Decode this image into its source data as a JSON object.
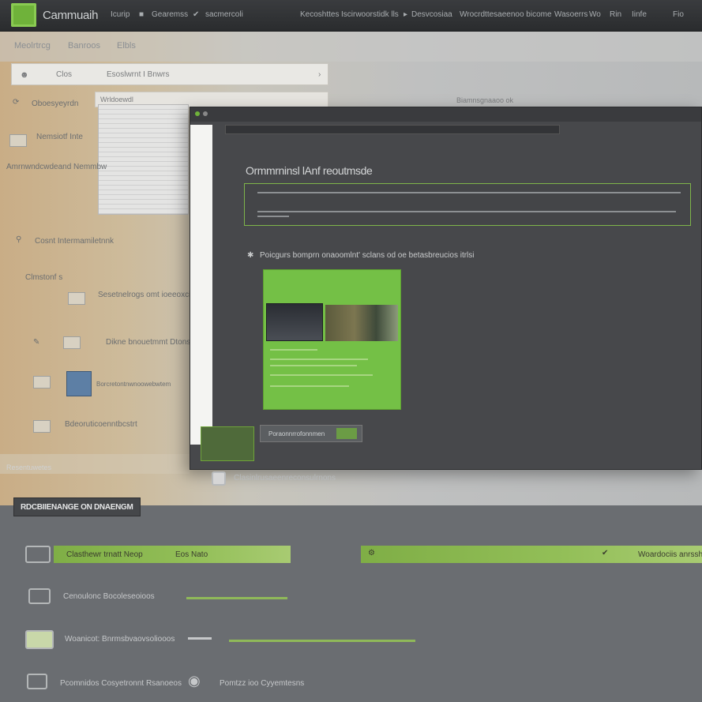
{
  "header": {
    "brand": "Cammuaih",
    "nav": [
      "Icurip",
      "Gearemss",
      "sacmercoli"
    ],
    "nav_right": [
      "Kecoshttes",
      "Iscirwoorstidk lls",
      "Desvcosiaa",
      "Wrocrdttesaeenoo bicome",
      "Wasoerrs",
      "Wo",
      "Rin",
      "Iinfe",
      "Fio"
    ]
  },
  "bg_window": {
    "tabs": [
      "Meolrtrcg",
      "Banroos",
      "Elbls"
    ],
    "address": [
      "Clos",
      "Esoslwrnt I Bnwrs"
    ],
    "address2": "Wrldoewdl",
    "sidebar": [
      "Oboesyeyrdn",
      "Nemsiotf Inte",
      "Amrnwndcwdeand Nemmbw",
      "Cosnt Intermamiletnnk",
      "Clmstonf s",
      "Sesetnelrogs omt ioeeoxcimmt",
      "Dikne bnouetmmt Dtonss",
      "Borcretontnwnoowebwtem",
      "Bdeoruticoenntbcstrt"
    ],
    "bottom_label": "Resentuwetes",
    "right_note": "Biamnsgnaaoo ok"
  },
  "fg_window": {
    "heading": "Ormmrninsl lAnf reoutmsde",
    "note": "Poicgurs bomprn onaoomlnt' sclans od oe betasbreucios itrlsi",
    "button_label": "Poraonnrrofonnmen"
  },
  "status_text": "Clasinlrusaeenreconsulrnons",
  "section": {
    "title": "RDCBIIENANGE ON DNAENGM",
    "rows": [
      {
        "label": "Clasthewr trnatt Neop",
        "sub": "Eos Nato",
        "right": "Woardociis anrsshcr"
      },
      {
        "label": "Cenoulonc Bocoleseoioos"
      },
      {
        "label": "Woanicot: Bnrmsbvaovsoliooos"
      },
      {
        "label": "Pcomnidos Cosyetronnt Rsanoeos",
        "sub": "Pomtzz ioo Cyyemtesns"
      }
    ]
  },
  "colors": {
    "accent": "#74c046",
    "topbar": "#2f3133",
    "window_dark": "#47484b",
    "background": "#6a6d71"
  },
  "icons": [
    "logo",
    "edit-icon",
    "check-icon",
    "star-icon",
    "folder-icon",
    "file-icon",
    "image-icon",
    "person-icon",
    "refresh-icon",
    "wifi-icon",
    "chat-icon"
  ]
}
